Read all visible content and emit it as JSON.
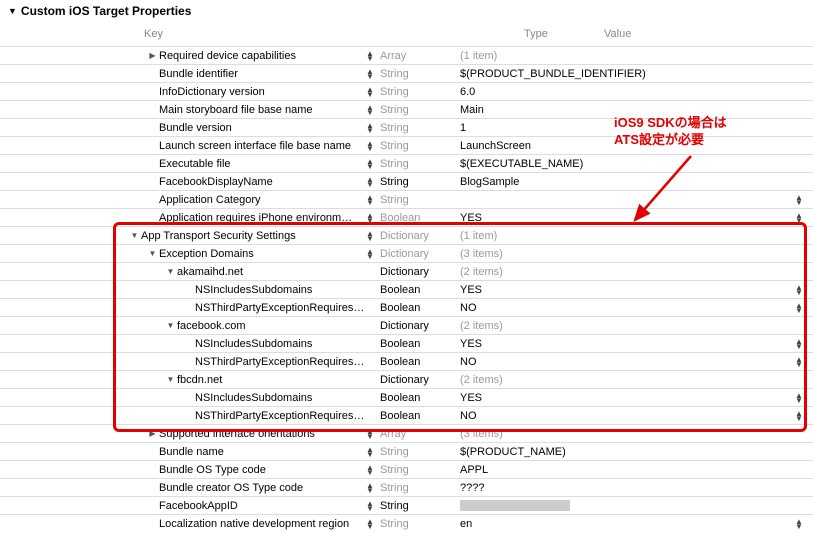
{
  "section_title": "Custom iOS Target Properties",
  "columns": {
    "key": "Key",
    "type": "Type",
    "value": "Value"
  },
  "annotation": {
    "line1": "iOS9 SDKの場合は",
    "line2": "ATS設定が必要"
  },
  "rows": [
    {
      "indent": 1,
      "tri": "right",
      "key": "Required device capabilities",
      "stepKey": true,
      "type": "Array",
      "typeDim": true,
      "value": "(1 item)",
      "valueDim": true,
      "stepVal": false
    },
    {
      "indent": 1,
      "tri": "",
      "key": "Bundle identifier",
      "stepKey": true,
      "type": "String",
      "typeDim": true,
      "value": "$(PRODUCT_BUNDLE_IDENTIFIER)",
      "valueDim": false,
      "stepVal": false
    },
    {
      "indent": 1,
      "tri": "",
      "key": "InfoDictionary version",
      "stepKey": true,
      "type": "String",
      "typeDim": true,
      "value": "6.0",
      "valueDim": false,
      "stepVal": false
    },
    {
      "indent": 1,
      "tri": "",
      "key": "Main storyboard file base name",
      "stepKey": true,
      "type": "String",
      "typeDim": true,
      "value": "Main",
      "valueDim": false,
      "stepVal": false
    },
    {
      "indent": 1,
      "tri": "",
      "key": "Bundle version",
      "stepKey": true,
      "type": "String",
      "typeDim": true,
      "value": "1",
      "valueDim": false,
      "stepVal": false
    },
    {
      "indent": 1,
      "tri": "",
      "key": "Launch screen interface file base name",
      "stepKey": true,
      "type": "String",
      "typeDim": true,
      "value": "LaunchScreen",
      "valueDim": false,
      "stepVal": false
    },
    {
      "indent": 1,
      "tri": "",
      "key": "Executable file",
      "stepKey": true,
      "type": "String",
      "typeDim": true,
      "value": "$(EXECUTABLE_NAME)",
      "valueDim": false,
      "stepVal": false
    },
    {
      "indent": 1,
      "tri": "",
      "key": "FacebookDisplayName",
      "stepKey": true,
      "type": "String",
      "typeDim": false,
      "value": "BlogSample",
      "valueDim": false,
      "stepVal": false
    },
    {
      "indent": 1,
      "tri": "",
      "key": "Application Category",
      "stepKey": true,
      "type": "String",
      "typeDim": true,
      "value": "",
      "valueDim": false,
      "stepVal": true
    },
    {
      "indent": 1,
      "tri": "",
      "key": "Application requires iPhone environm…",
      "stepKey": true,
      "type": "Boolean",
      "typeDim": true,
      "value": "YES",
      "valueDim": false,
      "stepVal": true
    },
    {
      "indent": 0,
      "tri": "down",
      "key": "App Transport Security Settings",
      "stepKey": true,
      "type": "Dictionary",
      "typeDim": true,
      "value": "(1 item)",
      "valueDim": true,
      "stepVal": false
    },
    {
      "indent": 1,
      "tri": "down",
      "key": "Exception Domains",
      "stepKey": true,
      "type": "Dictionary",
      "typeDim": true,
      "value": "(3 items)",
      "valueDim": true,
      "stepVal": false
    },
    {
      "indent": 2,
      "tri": "down",
      "key": "akamaihd.net",
      "stepKey": false,
      "type": "Dictionary",
      "typeDim": false,
      "value": "(2 items)",
      "valueDim": true,
      "stepVal": false
    },
    {
      "indent": 3,
      "tri": "",
      "key": "NSIncludesSubdomains",
      "stepKey": false,
      "type": "Boolean",
      "typeDim": false,
      "value": "YES",
      "valueDim": false,
      "stepVal": true
    },
    {
      "indent": 3,
      "tri": "",
      "key": "NSThirdPartyExceptionRequires…",
      "stepKey": false,
      "type": "Boolean",
      "typeDim": false,
      "value": "NO",
      "valueDim": false,
      "stepVal": true
    },
    {
      "indent": 2,
      "tri": "down",
      "key": "facebook.com",
      "stepKey": false,
      "type": "Dictionary",
      "typeDim": false,
      "value": "(2 items)",
      "valueDim": true,
      "stepVal": false
    },
    {
      "indent": 3,
      "tri": "",
      "key": "NSIncludesSubdomains",
      "stepKey": false,
      "type": "Boolean",
      "typeDim": false,
      "value": "YES",
      "valueDim": false,
      "stepVal": true
    },
    {
      "indent": 3,
      "tri": "",
      "key": "NSThirdPartyExceptionRequires…",
      "stepKey": false,
      "type": "Boolean",
      "typeDim": false,
      "value": "NO",
      "valueDim": false,
      "stepVal": true
    },
    {
      "indent": 2,
      "tri": "down",
      "key": "fbcdn.net",
      "stepKey": false,
      "type": "Dictionary",
      "typeDim": false,
      "value": "(2 items)",
      "valueDim": true,
      "stepVal": false
    },
    {
      "indent": 3,
      "tri": "",
      "key": "NSIncludesSubdomains",
      "stepKey": false,
      "type": "Boolean",
      "typeDim": false,
      "value": "YES",
      "valueDim": false,
      "stepVal": true
    },
    {
      "indent": 3,
      "tri": "",
      "key": "NSThirdPartyExceptionRequires…",
      "stepKey": false,
      "type": "Boolean",
      "typeDim": false,
      "value": "NO",
      "valueDim": false,
      "stepVal": true
    },
    {
      "indent": 1,
      "tri": "right",
      "key": "Supported interface orientations",
      "stepKey": true,
      "type": "Array",
      "typeDim": true,
      "value": "(3 items)",
      "valueDim": true,
      "stepVal": false
    },
    {
      "indent": 1,
      "tri": "",
      "key": "Bundle name",
      "stepKey": true,
      "type": "String",
      "typeDim": true,
      "value": "$(PRODUCT_NAME)",
      "valueDim": false,
      "stepVal": false
    },
    {
      "indent": 1,
      "tri": "",
      "key": "Bundle OS Type code",
      "stepKey": true,
      "type": "String",
      "typeDim": true,
      "value": "APPL",
      "valueDim": false,
      "stepVal": false
    },
    {
      "indent": 1,
      "tri": "",
      "key": "Bundle creator OS Type code",
      "stepKey": true,
      "type": "String",
      "typeDim": true,
      "value": "????",
      "valueDim": false,
      "stepVal": false
    },
    {
      "indent": 1,
      "tri": "",
      "key": "FacebookAppID",
      "stepKey": true,
      "type": "String",
      "typeDim": false,
      "value": "",
      "valueDim": false,
      "blur": true,
      "stepVal": false
    },
    {
      "indent": 1,
      "tri": "",
      "key": "Localization native development region",
      "stepKey": true,
      "type": "String",
      "typeDim": true,
      "value": "en",
      "valueDim": false,
      "stepVal": true
    }
  ]
}
